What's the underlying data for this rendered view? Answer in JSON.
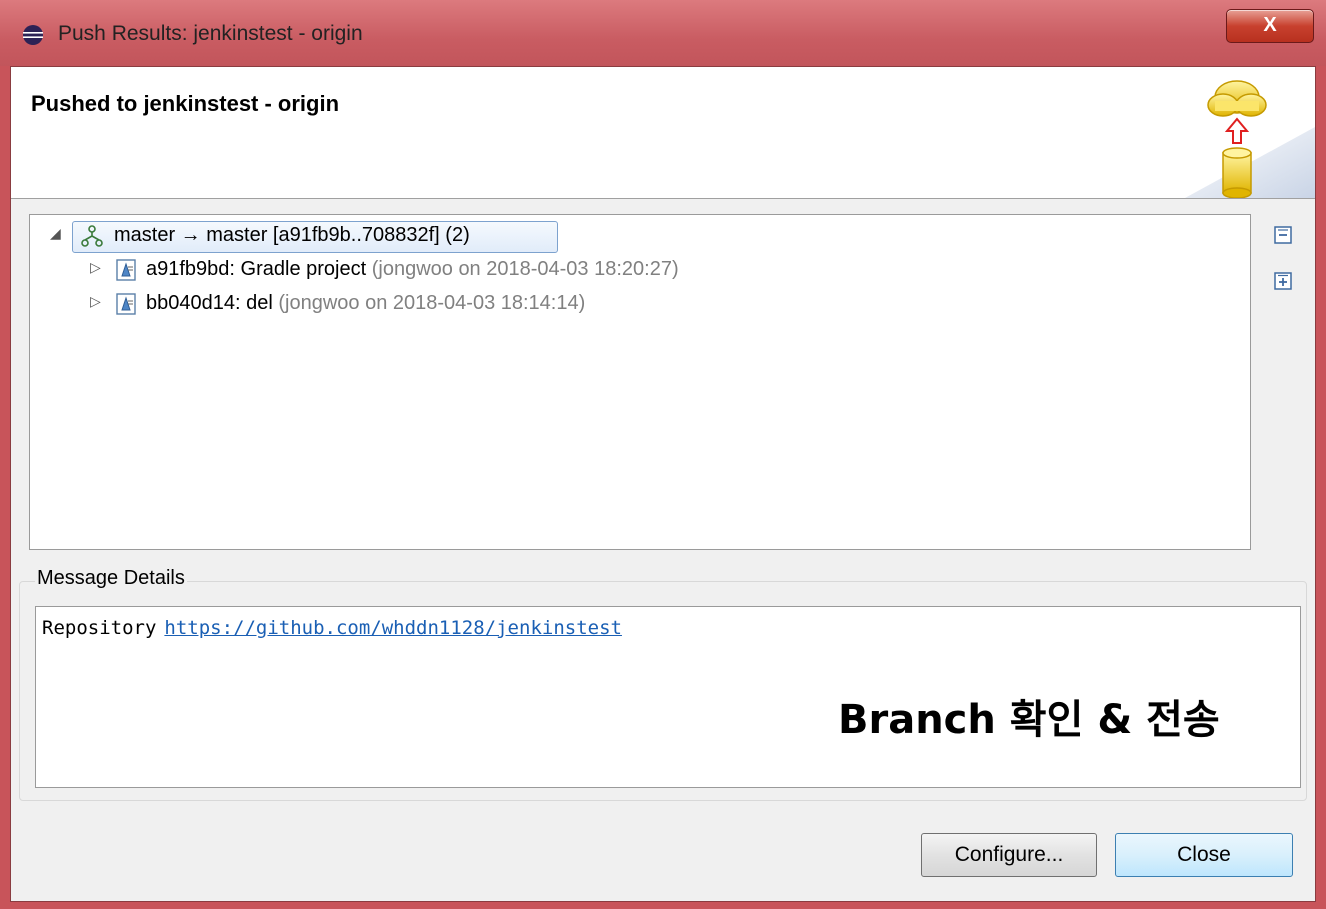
{
  "window": {
    "title": "Push Results: jenkinstest - origin",
    "close_glyph": "X"
  },
  "header": {
    "title": "Pushed to jenkinstest - origin"
  },
  "tree": {
    "branch": {
      "label": "master → master [a91fb9b..708832f] (2)",
      "icon": "branch-icon"
    },
    "commits": [
      {
        "title": "a91fb9bd: Gradle project",
        "meta": "(jongwoo on 2018-04-03 18:20:27)"
      },
      {
        "title": "bb040d14: del",
        "meta": "(jongwoo on 2018-04-03 18:14:14)"
      }
    ]
  },
  "side_buttons": {
    "collapse_all": "collapse-all-icon",
    "expand_all": "expand-all-icon"
  },
  "message_details": {
    "legend": "Message Details",
    "label": "Repository",
    "url": "https://github.com/whddn1128/jenkinstest"
  },
  "annotation": "Branch 확인 & 전송",
  "buttons": {
    "configure": "Configure...",
    "close": "Close"
  }
}
